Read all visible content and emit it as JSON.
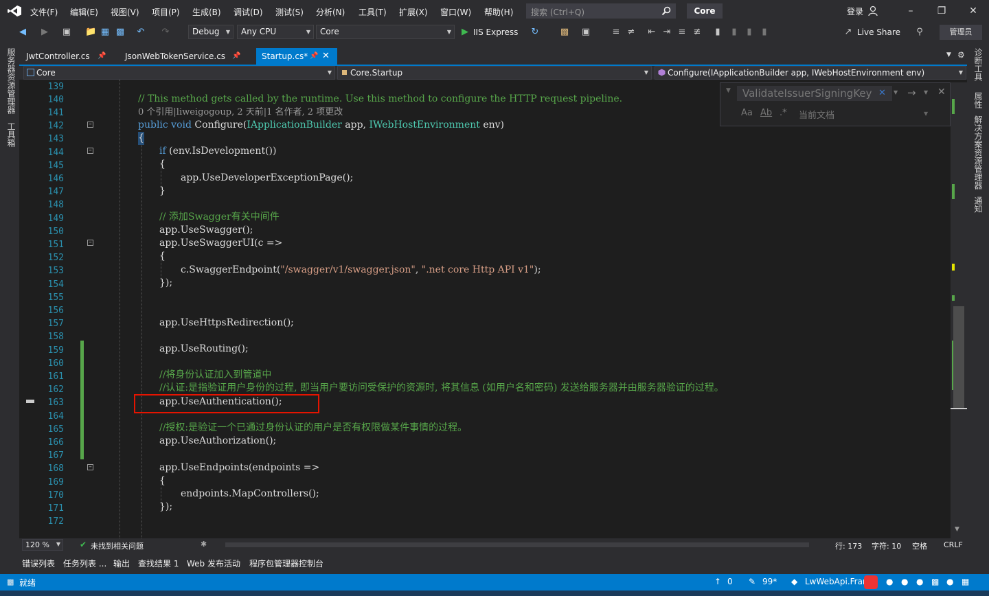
{
  "menu": [
    "文件(F)",
    "编辑(E)",
    "视图(V)",
    "项目(P)",
    "生成(B)",
    "调试(D)",
    "测试(S)",
    "分析(N)",
    "工具(T)",
    "扩展(X)",
    "窗口(W)",
    "帮助(H)"
  ],
  "search": {
    "placeholder": "搜索 (Ctrl+Q)"
  },
  "solution_name": "Core",
  "login_label": "登录",
  "toolbar": {
    "config": "Debug",
    "platform": "Any CPU",
    "startup_project": "Core",
    "run_label": "IIS Express",
    "live_share": "Live Share",
    "admin": "管理员"
  },
  "left_strip": [
    "服务器资源管理器",
    "工具箱"
  ],
  "right_strip": [
    "诊断工具",
    "属性",
    "解决方案资源管理器",
    "通知"
  ],
  "tabs": [
    {
      "label": "JwtController.cs",
      "active": false
    },
    {
      "label": "JsonWebTokenService.cs",
      "active": false
    },
    {
      "label": "Startup.cs*",
      "active": true
    }
  ],
  "nav": {
    "project": "Core",
    "class": "Core.Startup",
    "member": "Configure(IApplicationBuilder app, IWebHostEnvironment env)"
  },
  "find": {
    "value": "ValidateIssuerSigningKey",
    "options": [
      "Aa",
      "Ab",
      "当前文档"
    ]
  },
  "line_numbers": [
    "139",
    "140",
    "141",
    "142",
    "143",
    "144",
    "145",
    "146",
    "147",
    "148",
    "149",
    "150",
    "151",
    "152",
    "153",
    "154",
    "155",
    "156",
    "157",
    "158",
    "159",
    "160",
    "161",
    "162",
    "163",
    "164",
    "165",
    "166",
    "167",
    "168",
    "169",
    "170",
    "171",
    "172"
  ],
  "code": {
    "l140": "// This method gets called by the runtime. Use this method to configure the HTTP request pipeline.",
    "lens": "0 个引用|liweigogoup, 2 天前|1 名作者, 2 项更改",
    "l141_kw": "public void ",
    "l141_name": "Configure",
    "l141_p1": "(",
    "l141_t1": "IApplicationBuilder",
    "l141_p2": " app, ",
    "l141_t2": "IWebHostEnvironment",
    "l141_p3": " env)",
    "l142": "{",
    "l143_kw": "if",
    "l143_rest": " (env.IsDevelopment())",
    "l144": "{",
    "l145": "app.UseDeveloperExceptionPage();",
    "l146": "}",
    "l148": "// 添加Swagger有关中间件",
    "l149": "app.UseSwagger();",
    "l150": "app.UseSwaggerUI(c =>",
    "l151": "{",
    "l152_a": "c.SwaggerEndpoint(",
    "l152_s1": "\"/swagger/v1/swagger.json\"",
    "l152_b": ", ",
    "l152_s2": "\".net core Http API v1\"",
    "l152_c": ");",
    "l153": "});",
    "l156": "app.UseHttpsRedirection();",
    "l158": "app.UseRouting();",
    "l160": "//将身份认证加入到管道中",
    "l161": "//认证:是指验证用户身份的过程, 即当用户要访问受保护的资源时, 将其信息 (如用户名和密码) 发送给服务器并由服务器验证的过程。",
    "l162": "app.UseAuthentication();",
    "l164": "//授权:是验证一个已通过身份认证的用户是否有权限做某件事情的过程。",
    "l165": "app.UseAuthorization();",
    "l167": "app.UseEndpoints(endpoints =>",
    "l168": "{",
    "l169": "endpoints.MapControllers();",
    "l170": "});"
  },
  "editor_status": {
    "zoom": "120 %",
    "issues": "未找到相关问题",
    "line": "行: 173",
    "col": "字符: 10",
    "ws": "空格",
    "eol": "CRLF"
  },
  "bottom_tabs": [
    "错误列表",
    "任务列表 ...",
    "输出",
    "查找结果 1",
    "Web 发布活动",
    "程序包管理器控制台"
  ],
  "status": {
    "ready": "就绪",
    "up": "0",
    "edits": "99*",
    "repo": "LwWebApi.Frame"
  },
  "colors": {
    "accent": "#007acc",
    "highlight_box": "#e51400",
    "comment": "#57a64a",
    "keyword": "#569cd6",
    "type": "#4ec9b0",
    "string": "#d69d85"
  }
}
